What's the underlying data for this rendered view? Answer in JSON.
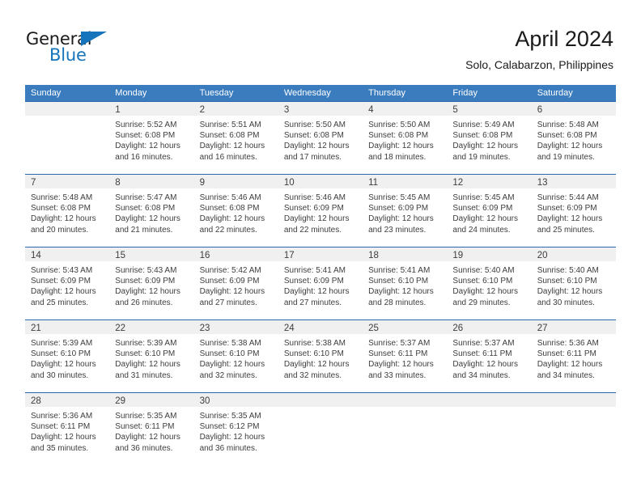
{
  "brand": {
    "name_part1": "General",
    "name_part2": "Blue",
    "accent_color": "#1574bb"
  },
  "header": {
    "title": "April 2024",
    "subtitle": "Solo, Calabarzon, Philippines"
  },
  "theme": {
    "header_row_bg": "#3a7cbe",
    "row_divider": "#2a67ad",
    "day_band_bg": "#f0f0f0",
    "text": "#3d3d3d"
  },
  "weekdays": [
    "Sunday",
    "Monday",
    "Tuesday",
    "Wednesday",
    "Thursday",
    "Friday",
    "Saturday"
  ],
  "weeks": [
    [
      {
        "day": "",
        "empty": true,
        "sunrise": "",
        "sunset": "",
        "daylight_line1": "",
        "daylight_line2": ""
      },
      {
        "day": "1",
        "sunrise": "Sunrise: 5:52 AM",
        "sunset": "Sunset: 6:08 PM",
        "daylight_line1": "Daylight: 12 hours",
        "daylight_line2": "and 16 minutes."
      },
      {
        "day": "2",
        "sunrise": "Sunrise: 5:51 AM",
        "sunset": "Sunset: 6:08 PM",
        "daylight_line1": "Daylight: 12 hours",
        "daylight_line2": "and 16 minutes."
      },
      {
        "day": "3",
        "sunrise": "Sunrise: 5:50 AM",
        "sunset": "Sunset: 6:08 PM",
        "daylight_line1": "Daylight: 12 hours",
        "daylight_line2": "and 17 minutes."
      },
      {
        "day": "4",
        "sunrise": "Sunrise: 5:50 AM",
        "sunset": "Sunset: 6:08 PM",
        "daylight_line1": "Daylight: 12 hours",
        "daylight_line2": "and 18 minutes."
      },
      {
        "day": "5",
        "sunrise": "Sunrise: 5:49 AM",
        "sunset": "Sunset: 6:08 PM",
        "daylight_line1": "Daylight: 12 hours",
        "daylight_line2": "and 19 minutes."
      },
      {
        "day": "6",
        "sunrise": "Sunrise: 5:48 AM",
        "sunset": "Sunset: 6:08 PM",
        "daylight_line1": "Daylight: 12 hours",
        "daylight_line2": "and 19 minutes."
      }
    ],
    [
      {
        "day": "7",
        "sunrise": "Sunrise: 5:48 AM",
        "sunset": "Sunset: 6:08 PM",
        "daylight_line1": "Daylight: 12 hours",
        "daylight_line2": "and 20 minutes."
      },
      {
        "day": "8",
        "sunrise": "Sunrise: 5:47 AM",
        "sunset": "Sunset: 6:08 PM",
        "daylight_line1": "Daylight: 12 hours",
        "daylight_line2": "and 21 minutes."
      },
      {
        "day": "9",
        "sunrise": "Sunrise: 5:46 AM",
        "sunset": "Sunset: 6:08 PM",
        "daylight_line1": "Daylight: 12 hours",
        "daylight_line2": "and 22 minutes."
      },
      {
        "day": "10",
        "sunrise": "Sunrise: 5:46 AM",
        "sunset": "Sunset: 6:09 PM",
        "daylight_line1": "Daylight: 12 hours",
        "daylight_line2": "and 22 minutes."
      },
      {
        "day": "11",
        "sunrise": "Sunrise: 5:45 AM",
        "sunset": "Sunset: 6:09 PM",
        "daylight_line1": "Daylight: 12 hours",
        "daylight_line2": "and 23 minutes."
      },
      {
        "day": "12",
        "sunrise": "Sunrise: 5:45 AM",
        "sunset": "Sunset: 6:09 PM",
        "daylight_line1": "Daylight: 12 hours",
        "daylight_line2": "and 24 minutes."
      },
      {
        "day": "13",
        "sunrise": "Sunrise: 5:44 AM",
        "sunset": "Sunset: 6:09 PM",
        "daylight_line1": "Daylight: 12 hours",
        "daylight_line2": "and 25 minutes."
      }
    ],
    [
      {
        "day": "14",
        "sunrise": "Sunrise: 5:43 AM",
        "sunset": "Sunset: 6:09 PM",
        "daylight_line1": "Daylight: 12 hours",
        "daylight_line2": "and 25 minutes."
      },
      {
        "day": "15",
        "sunrise": "Sunrise: 5:43 AM",
        "sunset": "Sunset: 6:09 PM",
        "daylight_line1": "Daylight: 12 hours",
        "daylight_line2": "and 26 minutes."
      },
      {
        "day": "16",
        "sunrise": "Sunrise: 5:42 AM",
        "sunset": "Sunset: 6:09 PM",
        "daylight_line1": "Daylight: 12 hours",
        "daylight_line2": "and 27 minutes."
      },
      {
        "day": "17",
        "sunrise": "Sunrise: 5:41 AM",
        "sunset": "Sunset: 6:09 PM",
        "daylight_line1": "Daylight: 12 hours",
        "daylight_line2": "and 27 minutes."
      },
      {
        "day": "18",
        "sunrise": "Sunrise: 5:41 AM",
        "sunset": "Sunset: 6:10 PM",
        "daylight_line1": "Daylight: 12 hours",
        "daylight_line2": "and 28 minutes."
      },
      {
        "day": "19",
        "sunrise": "Sunrise: 5:40 AM",
        "sunset": "Sunset: 6:10 PM",
        "daylight_line1": "Daylight: 12 hours",
        "daylight_line2": "and 29 minutes."
      },
      {
        "day": "20",
        "sunrise": "Sunrise: 5:40 AM",
        "sunset": "Sunset: 6:10 PM",
        "daylight_line1": "Daylight: 12 hours",
        "daylight_line2": "and 30 minutes."
      }
    ],
    [
      {
        "day": "21",
        "sunrise": "Sunrise: 5:39 AM",
        "sunset": "Sunset: 6:10 PM",
        "daylight_line1": "Daylight: 12 hours",
        "daylight_line2": "and 30 minutes."
      },
      {
        "day": "22",
        "sunrise": "Sunrise: 5:39 AM",
        "sunset": "Sunset: 6:10 PM",
        "daylight_line1": "Daylight: 12 hours",
        "daylight_line2": "and 31 minutes."
      },
      {
        "day": "23",
        "sunrise": "Sunrise: 5:38 AM",
        "sunset": "Sunset: 6:10 PM",
        "daylight_line1": "Daylight: 12 hours",
        "daylight_line2": "and 32 minutes."
      },
      {
        "day": "24",
        "sunrise": "Sunrise: 5:38 AM",
        "sunset": "Sunset: 6:10 PM",
        "daylight_line1": "Daylight: 12 hours",
        "daylight_line2": "and 32 minutes."
      },
      {
        "day": "25",
        "sunrise": "Sunrise: 5:37 AM",
        "sunset": "Sunset: 6:11 PM",
        "daylight_line1": "Daylight: 12 hours",
        "daylight_line2": "and 33 minutes."
      },
      {
        "day": "26",
        "sunrise": "Sunrise: 5:37 AM",
        "sunset": "Sunset: 6:11 PM",
        "daylight_line1": "Daylight: 12 hours",
        "daylight_line2": "and 34 minutes."
      },
      {
        "day": "27",
        "sunrise": "Sunrise: 5:36 AM",
        "sunset": "Sunset: 6:11 PM",
        "daylight_line1": "Daylight: 12 hours",
        "daylight_line2": "and 34 minutes."
      }
    ],
    [
      {
        "day": "28",
        "sunrise": "Sunrise: 5:36 AM",
        "sunset": "Sunset: 6:11 PM",
        "daylight_line1": "Daylight: 12 hours",
        "daylight_line2": "and 35 minutes."
      },
      {
        "day": "29",
        "sunrise": "Sunrise: 5:35 AM",
        "sunset": "Sunset: 6:11 PM",
        "daylight_line1": "Daylight: 12 hours",
        "daylight_line2": "and 36 minutes."
      },
      {
        "day": "30",
        "sunrise": "Sunrise: 5:35 AM",
        "sunset": "Sunset: 6:12 PM",
        "daylight_line1": "Daylight: 12 hours",
        "daylight_line2": "and 36 minutes."
      },
      {
        "day": "",
        "empty": true,
        "sunrise": "",
        "sunset": "",
        "daylight_line1": "",
        "daylight_line2": ""
      },
      {
        "day": "",
        "empty": true,
        "sunrise": "",
        "sunset": "",
        "daylight_line1": "",
        "daylight_line2": ""
      },
      {
        "day": "",
        "empty": true,
        "sunrise": "",
        "sunset": "",
        "daylight_line1": "",
        "daylight_line2": ""
      },
      {
        "day": "",
        "empty": true,
        "sunrise": "",
        "sunset": "",
        "daylight_line1": "",
        "daylight_line2": ""
      }
    ]
  ]
}
